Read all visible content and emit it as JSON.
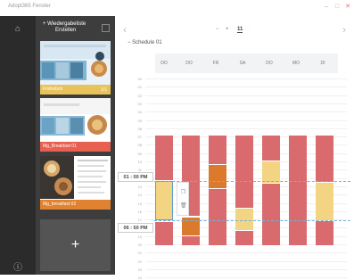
{
  "window": {
    "title": "Adopt365 Fenster",
    "min": "–",
    "max": "□",
    "close": "✕"
  },
  "rail": {
    "home_icon": "home-icon",
    "home_glyph": "⌂",
    "info_glyph": "ⓘ"
  },
  "panel": {
    "add_label": "+ Wiedergabeliste",
    "add_sublabel": "Erstellen",
    "slides": [
      {
        "label": "Frühstück",
        "num": "1/1",
        "color": "#e8c25a"
      },
      {
        "label": "Mg_Breakfast 01",
        "num": "",
        "color": "#e8604f"
      },
      {
        "label": "Mg_breakfast 02",
        "num": "",
        "color": "#e0822f"
      }
    ],
    "add_slide": "+"
  },
  "toolbar": {
    "prev": "‹",
    "next": "›",
    "zoom_out": "−",
    "zoom_in": "+",
    "zoom_value": "11"
  },
  "schedule": {
    "title": "− Schedule 01",
    "days": [
      "DO",
      "DO",
      "FR",
      "SA",
      "DO",
      "MO",
      "DI"
    ],
    "hours": [
      "00",
      "01",
      "02",
      "03",
      "04",
      "05",
      "06",
      "07",
      "08",
      "09",
      "10",
      "11",
      "12",
      "13",
      "14",
      "15",
      "16",
      "17",
      "18",
      "19",
      "20",
      "21",
      "22",
      "23",
      "24"
    ],
    "start_time": "01 : 00 PM",
    "end_time": "06 : 50 PM"
  },
  "colors": {
    "red": "#d96a6e",
    "orange": "#db7a2d",
    "yellow": "#f2d482",
    "accent": "#5a9fd4"
  }
}
